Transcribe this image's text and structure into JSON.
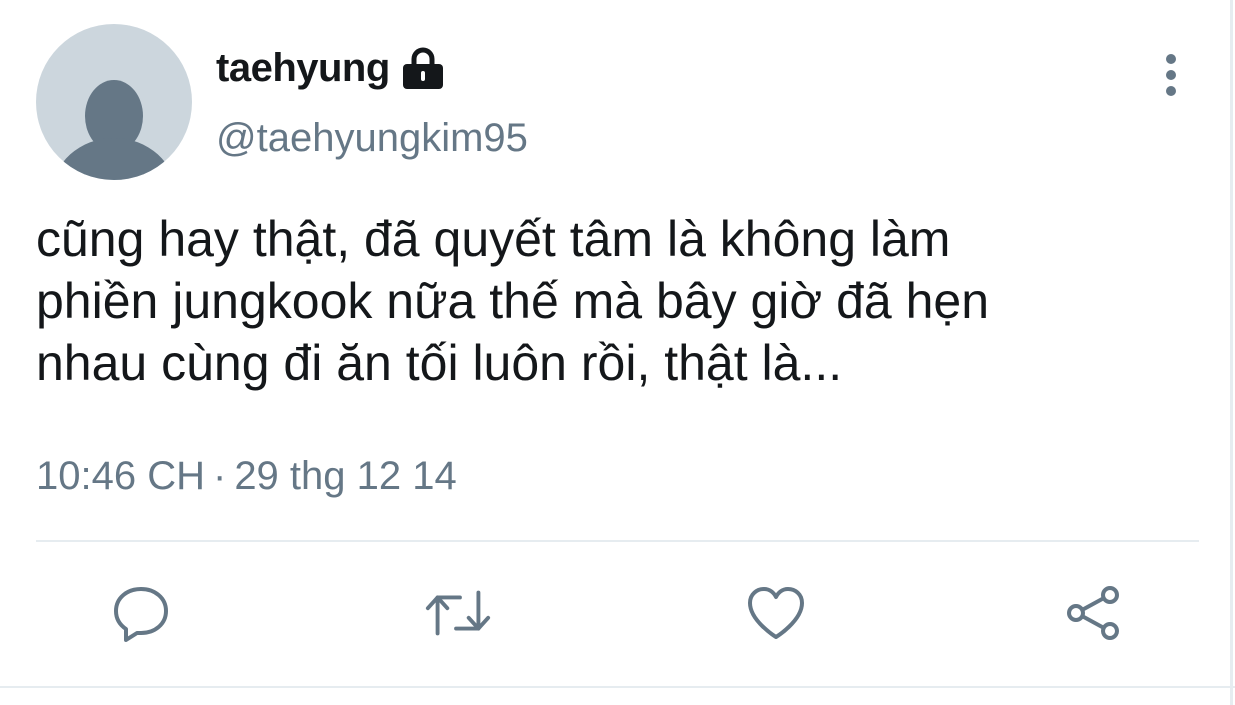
{
  "tweet": {
    "author": {
      "display_name": "taehyung",
      "handle": "@taehyungkim95",
      "avatar_icon": "default-avatar-icon",
      "protected_icon": "lock-icon"
    },
    "text": "cũng hay thật, đã quyết tâm là không làm\nphiền jungkook nữa thế mà bây giờ đã hẹn\nnhau cùng đi ăn tối luôn rồi, thật là...",
    "time": "10:46 CH",
    "separator": "·",
    "date": "29 thg 12 14"
  },
  "actions": {
    "reply_icon": "comment-icon",
    "retweet_icon": "retweet-icon",
    "like_icon": "heart-icon",
    "share_icon": "share-icon",
    "more_icon": "more-vertical-icon"
  },
  "colors": {
    "text_primary": "#14171a",
    "text_secondary": "#657786",
    "icon": "#657786",
    "avatar_bg": "#ccd6dd",
    "avatar_figure": "#657786",
    "divider": "#e6ecf0"
  }
}
